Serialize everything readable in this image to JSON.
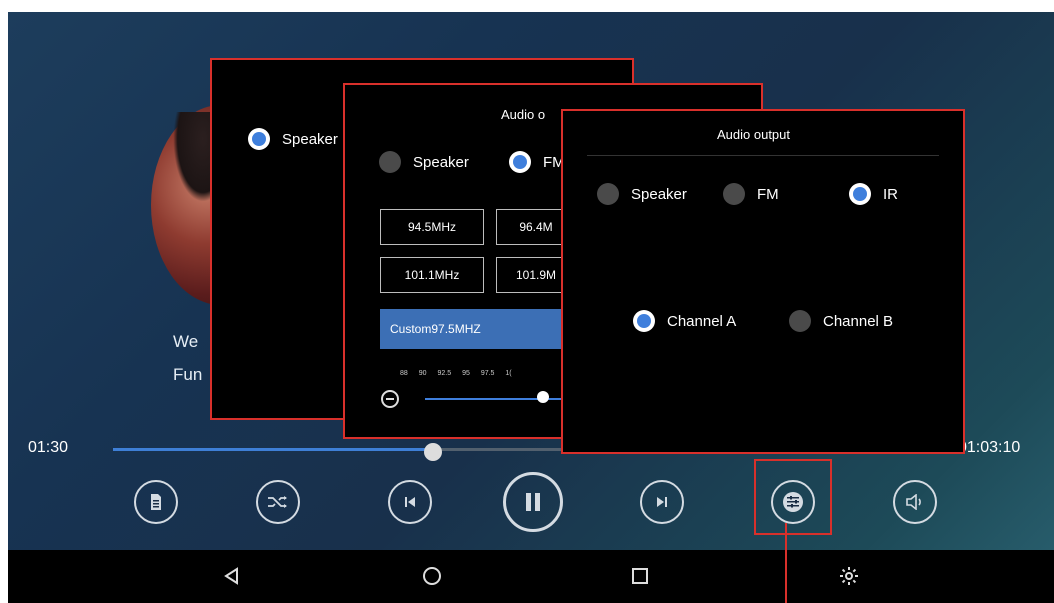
{
  "player": {
    "track_title": "We",
    "track_artist": "Fun",
    "time_current": "01:30",
    "time_total": "01:03:10",
    "progress_fraction": 0.39
  },
  "controls": [
    {
      "name": "playlist-button",
      "icon": "file-icon"
    },
    {
      "name": "shuffle-button",
      "icon": "shuffle-icon"
    },
    {
      "name": "previous-button",
      "icon": "skip-previous-icon"
    },
    {
      "name": "pause-button",
      "icon": "pause-icon"
    },
    {
      "name": "next-button",
      "icon": "skip-next-icon"
    },
    {
      "name": "equalizer-button",
      "icon": "equalizer-icon"
    },
    {
      "name": "volume-button",
      "icon": "volume-icon"
    }
  ],
  "panel1": {
    "speaker_label": "Speaker"
  },
  "panel2": {
    "title": "Audio o",
    "speaker_label": "Speaker",
    "fm_label": "FM",
    "freqs": [
      "94.5MHz",
      "96.4M",
      "101.1MHz",
      "101.9M"
    ],
    "custom_label": "Custom97.5MHZ",
    "scale": [
      "88",
      "90",
      "92.5",
      "95",
      "97.5",
      "1("
    ]
  },
  "panel3": {
    "title": "Audio output",
    "speaker_label": "Speaker",
    "fm_label": "FM",
    "ir_label": "IR",
    "channel_a_label": "Channel A",
    "channel_b_label": "Channel B"
  },
  "colors": {
    "accent": "#3f7fdc",
    "highlight": "#d9302b"
  }
}
